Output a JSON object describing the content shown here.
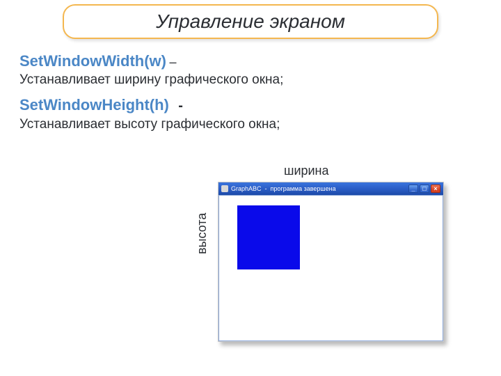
{
  "title": "Управление экраном",
  "commands": [
    {
      "name": "SetWindowWidth(w)",
      "separator": "–",
      "description": "Устанавливает ширину графического окна;"
    },
    {
      "name": "SetWindowHeight(h)",
      "separator": "-",
      "description": "Устанавливает высоту графического окна;"
    }
  ],
  "labels": {
    "width": "ширина",
    "height": "высота"
  },
  "window": {
    "app_name": "GraphABC",
    "status": "программа завершена",
    "buttons": {
      "min": "_",
      "max": "□",
      "close": "×"
    }
  }
}
